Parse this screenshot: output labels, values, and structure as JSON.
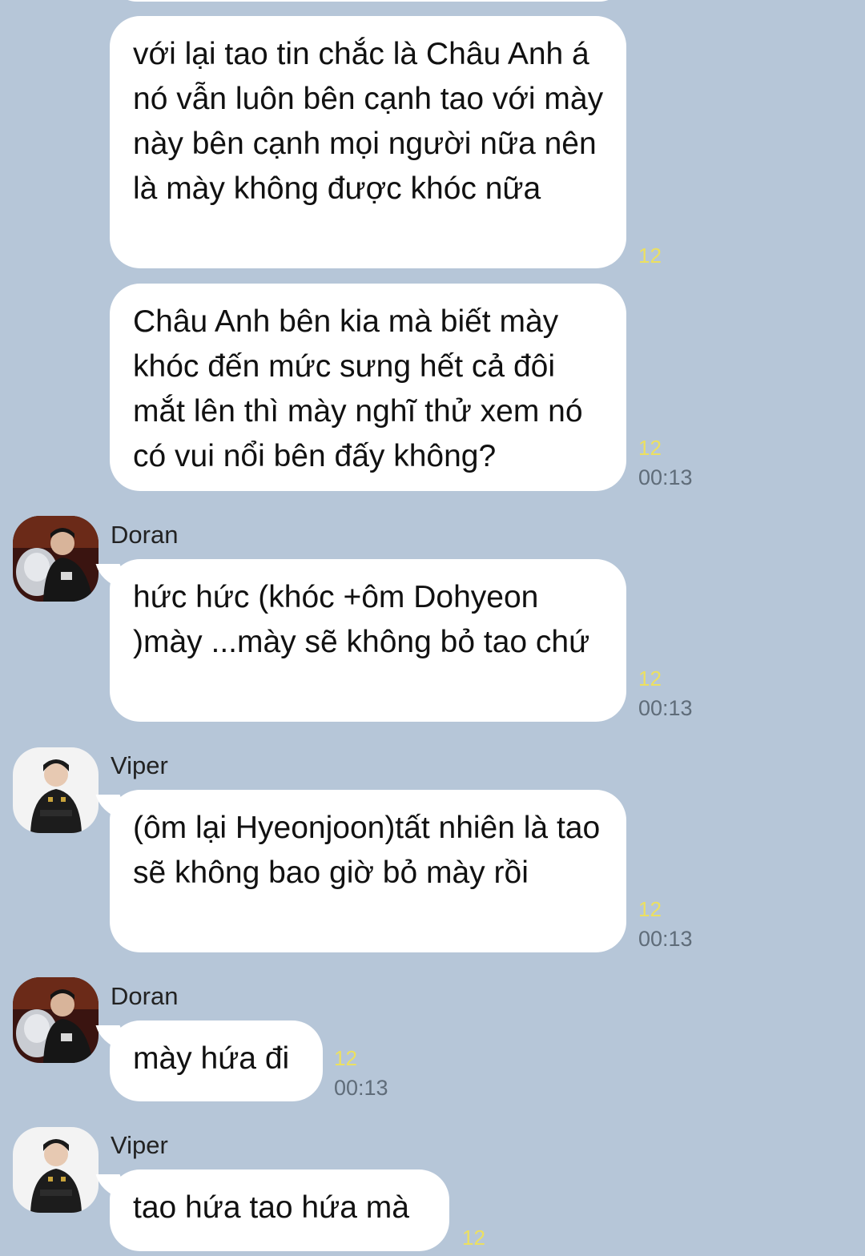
{
  "messages": [
    {
      "text": "với lại tao tin chắc là Châu Anh á nó vẫn luôn bên cạnh tao với mày này bên cạnh mọi người nữa nên là mày không được khóc nữa",
      "read": "12",
      "time": ""
    },
    {
      "text": "Châu Anh bên kia mà biết mày khóc đến mức sưng hết cả đôi mắt lên thì mày nghĩ thử xem nó có vui nổi bên đấy không?",
      "read": "12",
      "time": "00:13"
    },
    {
      "sender": "Doran",
      "avatar_icon": "doran-avatar-icon",
      "text": "hức hức (khóc +ôm Dohyeon )mày ...mày sẽ không bỏ tao chứ",
      "read": "12",
      "time": "00:13"
    },
    {
      "sender": "Viper",
      "avatar_icon": "viper-avatar-icon",
      "text": "(ôm lại Hyeonjoon)tất nhiên là tao sẽ không bao giờ bỏ mày rồi",
      "read": "12",
      "time": "00:13"
    },
    {
      "sender": "Doran",
      "avatar_icon": "doran-avatar-icon",
      "text": "mày hứa đi",
      "read": "12",
      "time": "00:13"
    },
    {
      "sender": "Viper",
      "avatar_icon": "viper-avatar-icon",
      "text": "tao hứa tao hứa mà",
      "read": "12",
      "time": ""
    }
  ],
  "colors": {
    "background": "#b6c6d8",
    "bubble": "#ffffff",
    "read_count": "#ece060",
    "timestamp": "#5f6c79"
  }
}
